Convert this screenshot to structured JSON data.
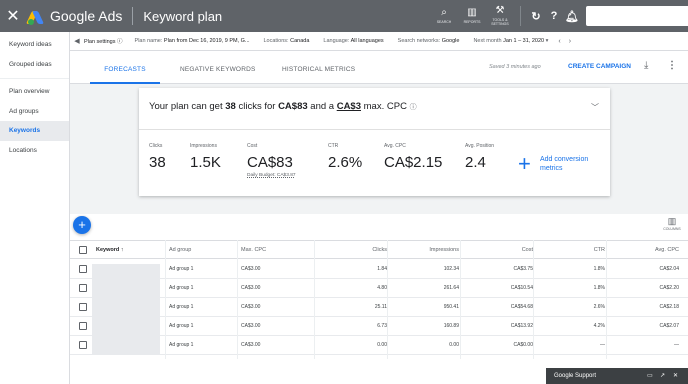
{
  "topbar": {
    "close_icon": "close-icon",
    "app_name": "Google Ads",
    "page_title": "Keyword plan",
    "tools": [
      {
        "icon": "search-icon",
        "label": "SEARCH"
      },
      {
        "icon": "reports-icon",
        "label": "REPORTS"
      },
      {
        "icon": "tools-icon",
        "label": "TOOLS & SETTINGS"
      }
    ],
    "refresh_icon": "refresh-icon",
    "help_icon": "help-icon",
    "notifications_icon": "bell-icon"
  },
  "sidebar": {
    "items": [
      {
        "label": "Keyword ideas",
        "active": false
      },
      {
        "label": "Grouped ideas",
        "active": false
      },
      {
        "label": "Plan overview",
        "active": false
      },
      {
        "label": "Ad groups",
        "active": false
      },
      {
        "label": "Keywords",
        "active": true
      },
      {
        "label": "Locations",
        "active": false
      }
    ]
  },
  "settings": {
    "title": "Plan settings",
    "plan_name_label": "Plan name:",
    "plan_name": "Plan from Dec 16, 2019, 9 PM, G...",
    "locations_label": "Locations:",
    "locations": "Canada",
    "language_label": "Language:",
    "language": "All languages",
    "networks_label": "Search networks:",
    "networks": "Google",
    "period_label": "Next month",
    "period": "Jan 1 – 31, 2020"
  },
  "tabs": {
    "items": [
      "FORECASTS",
      "NEGATIVE KEYWORDS",
      "HISTORICAL METRICS"
    ],
    "active": 0,
    "saved": "Saved 3 minutes ago",
    "create_campaign": "CREATE CAMPAIGN"
  },
  "forecast": {
    "head_prefix": "Your plan can get",
    "clicks": "38",
    "head_mid1": "clicks for",
    "cost": "CA$83",
    "head_mid2": "and a",
    "max_cpc": "CA$3",
    "head_suffix": "max. CPC",
    "metrics": [
      {
        "label": "Clicks",
        "value": "38"
      },
      {
        "label": "Impressions",
        "value": "1.5K"
      },
      {
        "label": "Cost",
        "value": "CA$83",
        "sub": "Daily Budget: CA$3.87"
      },
      {
        "label": "CTR",
        "value": "2.6%"
      },
      {
        "label": "Avg. CPC",
        "value": "CA$2.15"
      },
      {
        "label": "Avg. Position",
        "value": "2.4"
      }
    ],
    "add_conversion": "Add conversion metrics"
  },
  "table": {
    "columns_label": "COLUMNS",
    "headers": [
      "Keyword",
      "Ad group",
      "Max. CPC",
      "Clicks",
      "Impressions",
      "Cost",
      "CTR",
      "Avg. CPC"
    ],
    "rows": [
      {
        "ad_group": "Ad group 1",
        "max_cpc": "CA$3.00",
        "clicks": "1.84",
        "impressions": "102.34",
        "cost": "CA$3.75",
        "ctr": "1.8%",
        "avg_cpc": "CA$2.04"
      },
      {
        "ad_group": "Ad group 1",
        "max_cpc": "CA$3.00",
        "clicks": "4.80",
        "impressions": "261.64",
        "cost": "CA$10.54",
        "ctr": "1.8%",
        "avg_cpc": "CA$2.20"
      },
      {
        "ad_group": "Ad group 1",
        "max_cpc": "CA$3.00",
        "clicks": "25.11",
        "impressions": "950.41",
        "cost": "CA$54.68",
        "ctr": "2.6%",
        "avg_cpc": "CA$2.18"
      },
      {
        "ad_group": "Ad group 1",
        "max_cpc": "CA$3.00",
        "clicks": "6.73",
        "impressions": "160.89",
        "cost": "CA$13.92",
        "ctr": "4.2%",
        "avg_cpc": "CA$2.07"
      },
      {
        "ad_group": "Ad group 1",
        "max_cpc": "CA$3.00",
        "clicks": "0.00",
        "impressions": "0.00",
        "cost": "CA$0.00",
        "ctr": "—",
        "avg_cpc": "—"
      }
    ]
  },
  "support": {
    "title": "Google Support"
  }
}
